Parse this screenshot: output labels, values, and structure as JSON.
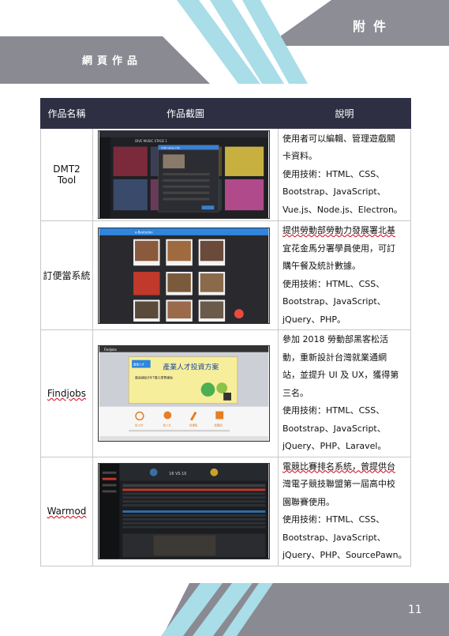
{
  "header": {
    "appendix_title": "附件",
    "section_title": "網頁作品"
  },
  "table": {
    "headers": [
      "作品名稱",
      "作品截圖",
      "說明"
    ],
    "rows": [
      {
        "name": "DMT2 Tool",
        "desc_lines": [
          "使用者可以編輯、管理遊戲關",
          "卡資料。",
          "使用技術：HTML、CSS、",
          "Bootstrap、JavaScript、",
          "Vue.js、Node.js、Electron。"
        ],
        "shot_title": "DIVE MUSIC STAGE 1",
        "shot_dialog": "Edit song info"
      },
      {
        "name": "訂便當系統",
        "desc_lines": [
          "提供勞動部勞動力發展署北基",
          "宜花金馬分署學員使用，可訂",
          "購午餐及統計數據。",
          "使用技術：HTML、CSS、",
          "Bootstrap、JavaScript、",
          "jQuery、PHP。"
        ],
        "shot_title": "e-Bentodon"
      },
      {
        "name": "Findjobs",
        "desc_lines": [
          "參加 2018 勞動部黑客松活",
          "動，重新設計台灣就業通網",
          "站，並提升 UI 及 UX，獲得第",
          "三名。",
          "使用技術：HTML、CSS、",
          "Bootstrap、JavaScript、",
          "jQuery、PHP、Laravel。"
        ],
        "shot_title": "Findjobs",
        "shot_banner": "產業人才投資方案",
        "shot_banner_small": "最高補助3年7萬元學費補助",
        "shot_banner_tag": "產業人才",
        "shot_icon_labels": [
          "找工作",
          "找人才",
          "找課程",
          "找職訓"
        ]
      },
      {
        "name": "Warmod",
        "desc_lines": [
          "電競比賽排名系統，曾提供台",
          "灣電子競技聯盟第一屆高中校",
          "園聯賽使用。",
          "使用技術：HTML、CSS、",
          "Bootstrap、JavaScript、",
          "jQuery、PHP、SourcePawn。"
        ],
        "shot_score": "16 VS 10"
      }
    ]
  },
  "footer": {
    "page_number": "11"
  },
  "colors": {
    "header_gray": "#8a8a92",
    "table_header": "#2f2f44",
    "stripe_cyan": "#a9dde8",
    "spell_underline": "#d0021b"
  }
}
